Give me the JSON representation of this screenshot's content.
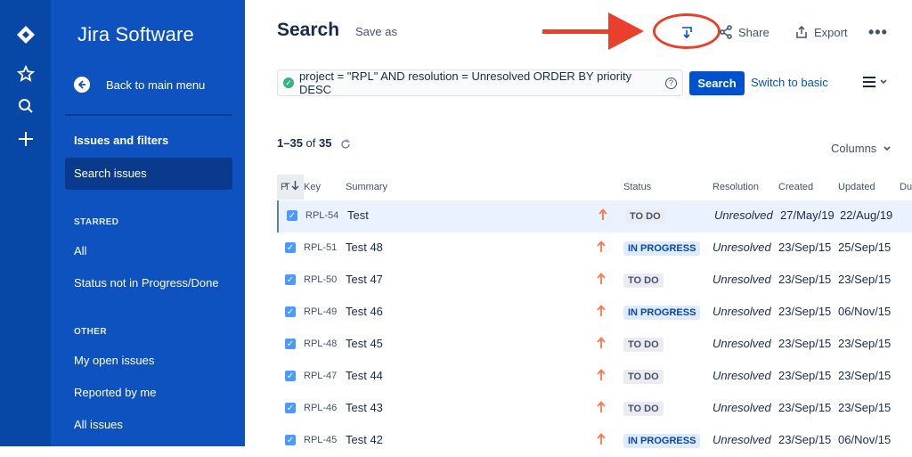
{
  "app": {
    "brand": "Jira Software"
  },
  "sidebar": {
    "back_label": "Back to main menu",
    "section_title": "Issues and filters",
    "search_issues": "Search issues",
    "starred_label": "STARRED",
    "starred_items": [
      "All",
      "Status not in Progress/Done"
    ],
    "other_label": "OTHER",
    "other_items": [
      "My open issues",
      "Reported by me",
      "All issues"
    ]
  },
  "header": {
    "title": "Search",
    "save_as": "Save as",
    "share": "Share",
    "export": "Export",
    "more": "•••"
  },
  "query": {
    "jql": "project = \"RPL\" AND resolution = Unresolved ORDER BY priority DESC",
    "search_button": "Search",
    "switch_basic": "Switch to basic"
  },
  "results": {
    "range": "1–35",
    "of_label": "of",
    "total": "35",
    "columns_label": "Columns"
  },
  "table": {
    "headers": {
      "type": "T",
      "key": "Key",
      "summary": "Summary",
      "priority": "P",
      "status": "Status",
      "resolution": "Resolution",
      "created": "Created",
      "updated": "Updated",
      "due": "Du"
    },
    "rows": [
      {
        "key": "RPL-54",
        "summary": "Test",
        "status": "TO DO",
        "resolution": "Unresolved",
        "created": "27/May/19",
        "updated": "22/Aug/19",
        "due": "",
        "selected": true
      },
      {
        "key": "RPL-51",
        "summary": "Test 48",
        "status": "IN PROGRESS",
        "resolution": "Unresolved",
        "created": "23/Sep/15",
        "updated": "25/Sep/15",
        "due": ""
      },
      {
        "key": "RPL-50",
        "summary": "Test 47",
        "status": "TO DO",
        "resolution": "Unresolved",
        "created": "23/Sep/15",
        "updated": "23/Sep/15",
        "due": ""
      },
      {
        "key": "RPL-49",
        "summary": "Test 46",
        "status": "IN PROGRESS",
        "resolution": "Unresolved",
        "created": "23/Sep/15",
        "updated": "06/Nov/15",
        "due": ""
      },
      {
        "key": "RPL-48",
        "summary": "Test 45",
        "status": "TO DO",
        "resolution": "Unresolved",
        "created": "23/Sep/15",
        "updated": "23/Sep/15",
        "due": ""
      },
      {
        "key": "RPL-47",
        "summary": "Test 44",
        "status": "TO DO",
        "resolution": "Unresolved",
        "created": "23/Sep/15",
        "updated": "23/Sep/15",
        "due": ""
      },
      {
        "key": "RPL-46",
        "summary": "Test 43",
        "status": "TO DO",
        "resolution": "Unresolved",
        "created": "23/Sep/15",
        "updated": "23/Sep/15",
        "due": ""
      },
      {
        "key": "RPL-45",
        "summary": "Test 42",
        "status": "IN PROGRESS",
        "resolution": "Unresolved",
        "created": "23/Sep/15",
        "updated": "06/Nov/15",
        "due": ""
      }
    ]
  },
  "colors": {
    "rail": "#0747a6",
    "sidebar": "#0d52bf",
    "primary": "#0052cc",
    "annotation": "#e8402a",
    "priority_high": "#ff7452"
  }
}
